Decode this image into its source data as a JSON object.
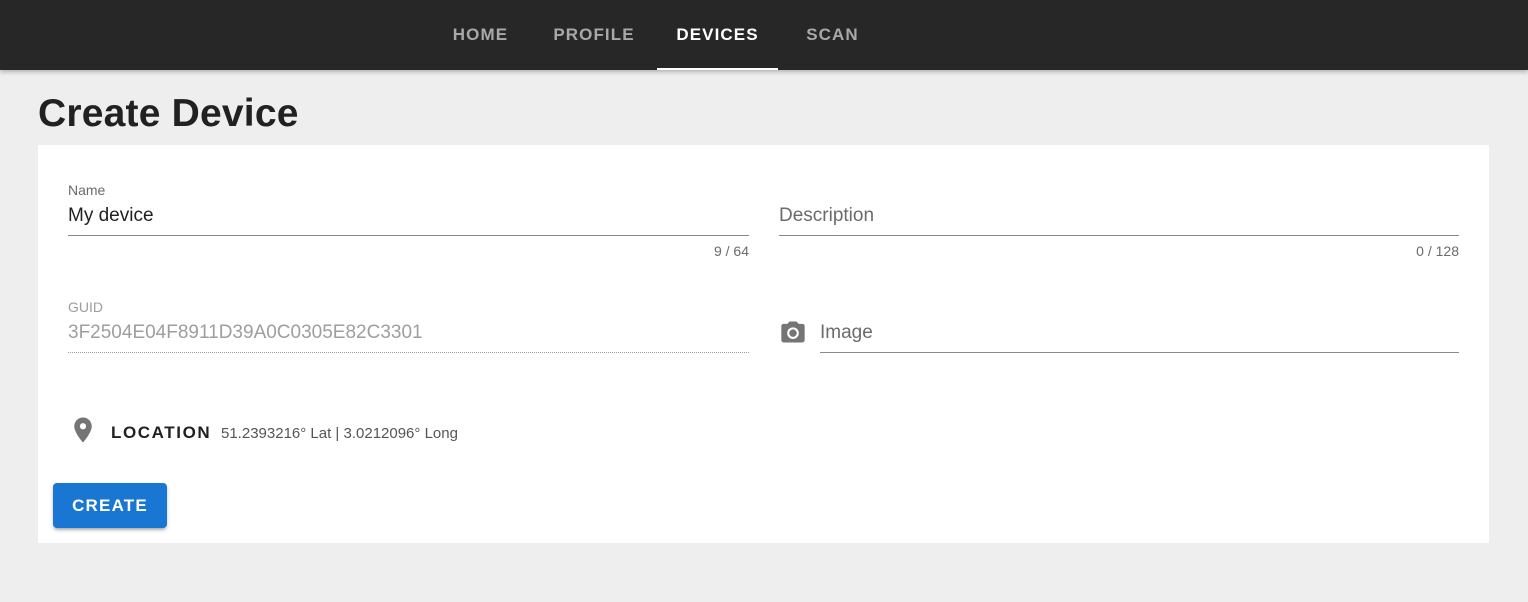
{
  "nav": {
    "tabs": [
      {
        "label": "HOME"
      },
      {
        "label": "PROFILE"
      },
      {
        "label": "DEVICES",
        "active": true
      },
      {
        "label": "SCAN"
      }
    ]
  },
  "page": {
    "title": "Create Device"
  },
  "form": {
    "name": {
      "label": "Name",
      "value": "My device",
      "counter": "9 / 64"
    },
    "description": {
      "placeholder": "Description",
      "value": "",
      "counter": "0 / 128"
    },
    "guid": {
      "label": "GUID",
      "value": "3F2504E04F8911D39A0C0305E82C3301",
      "disabled": true
    },
    "image": {
      "placeholder": "Image",
      "icon": "camera-icon"
    },
    "location": {
      "icon": "map-marker-icon",
      "label": "LOCATION",
      "coords": "51.2393216° Lat | 3.0212096° Long"
    },
    "create_label": "CREATE"
  },
  "colors": {
    "topbar": "#272727",
    "background": "#eeeeee",
    "primary": "#1976d2",
    "card": "#ffffff"
  }
}
